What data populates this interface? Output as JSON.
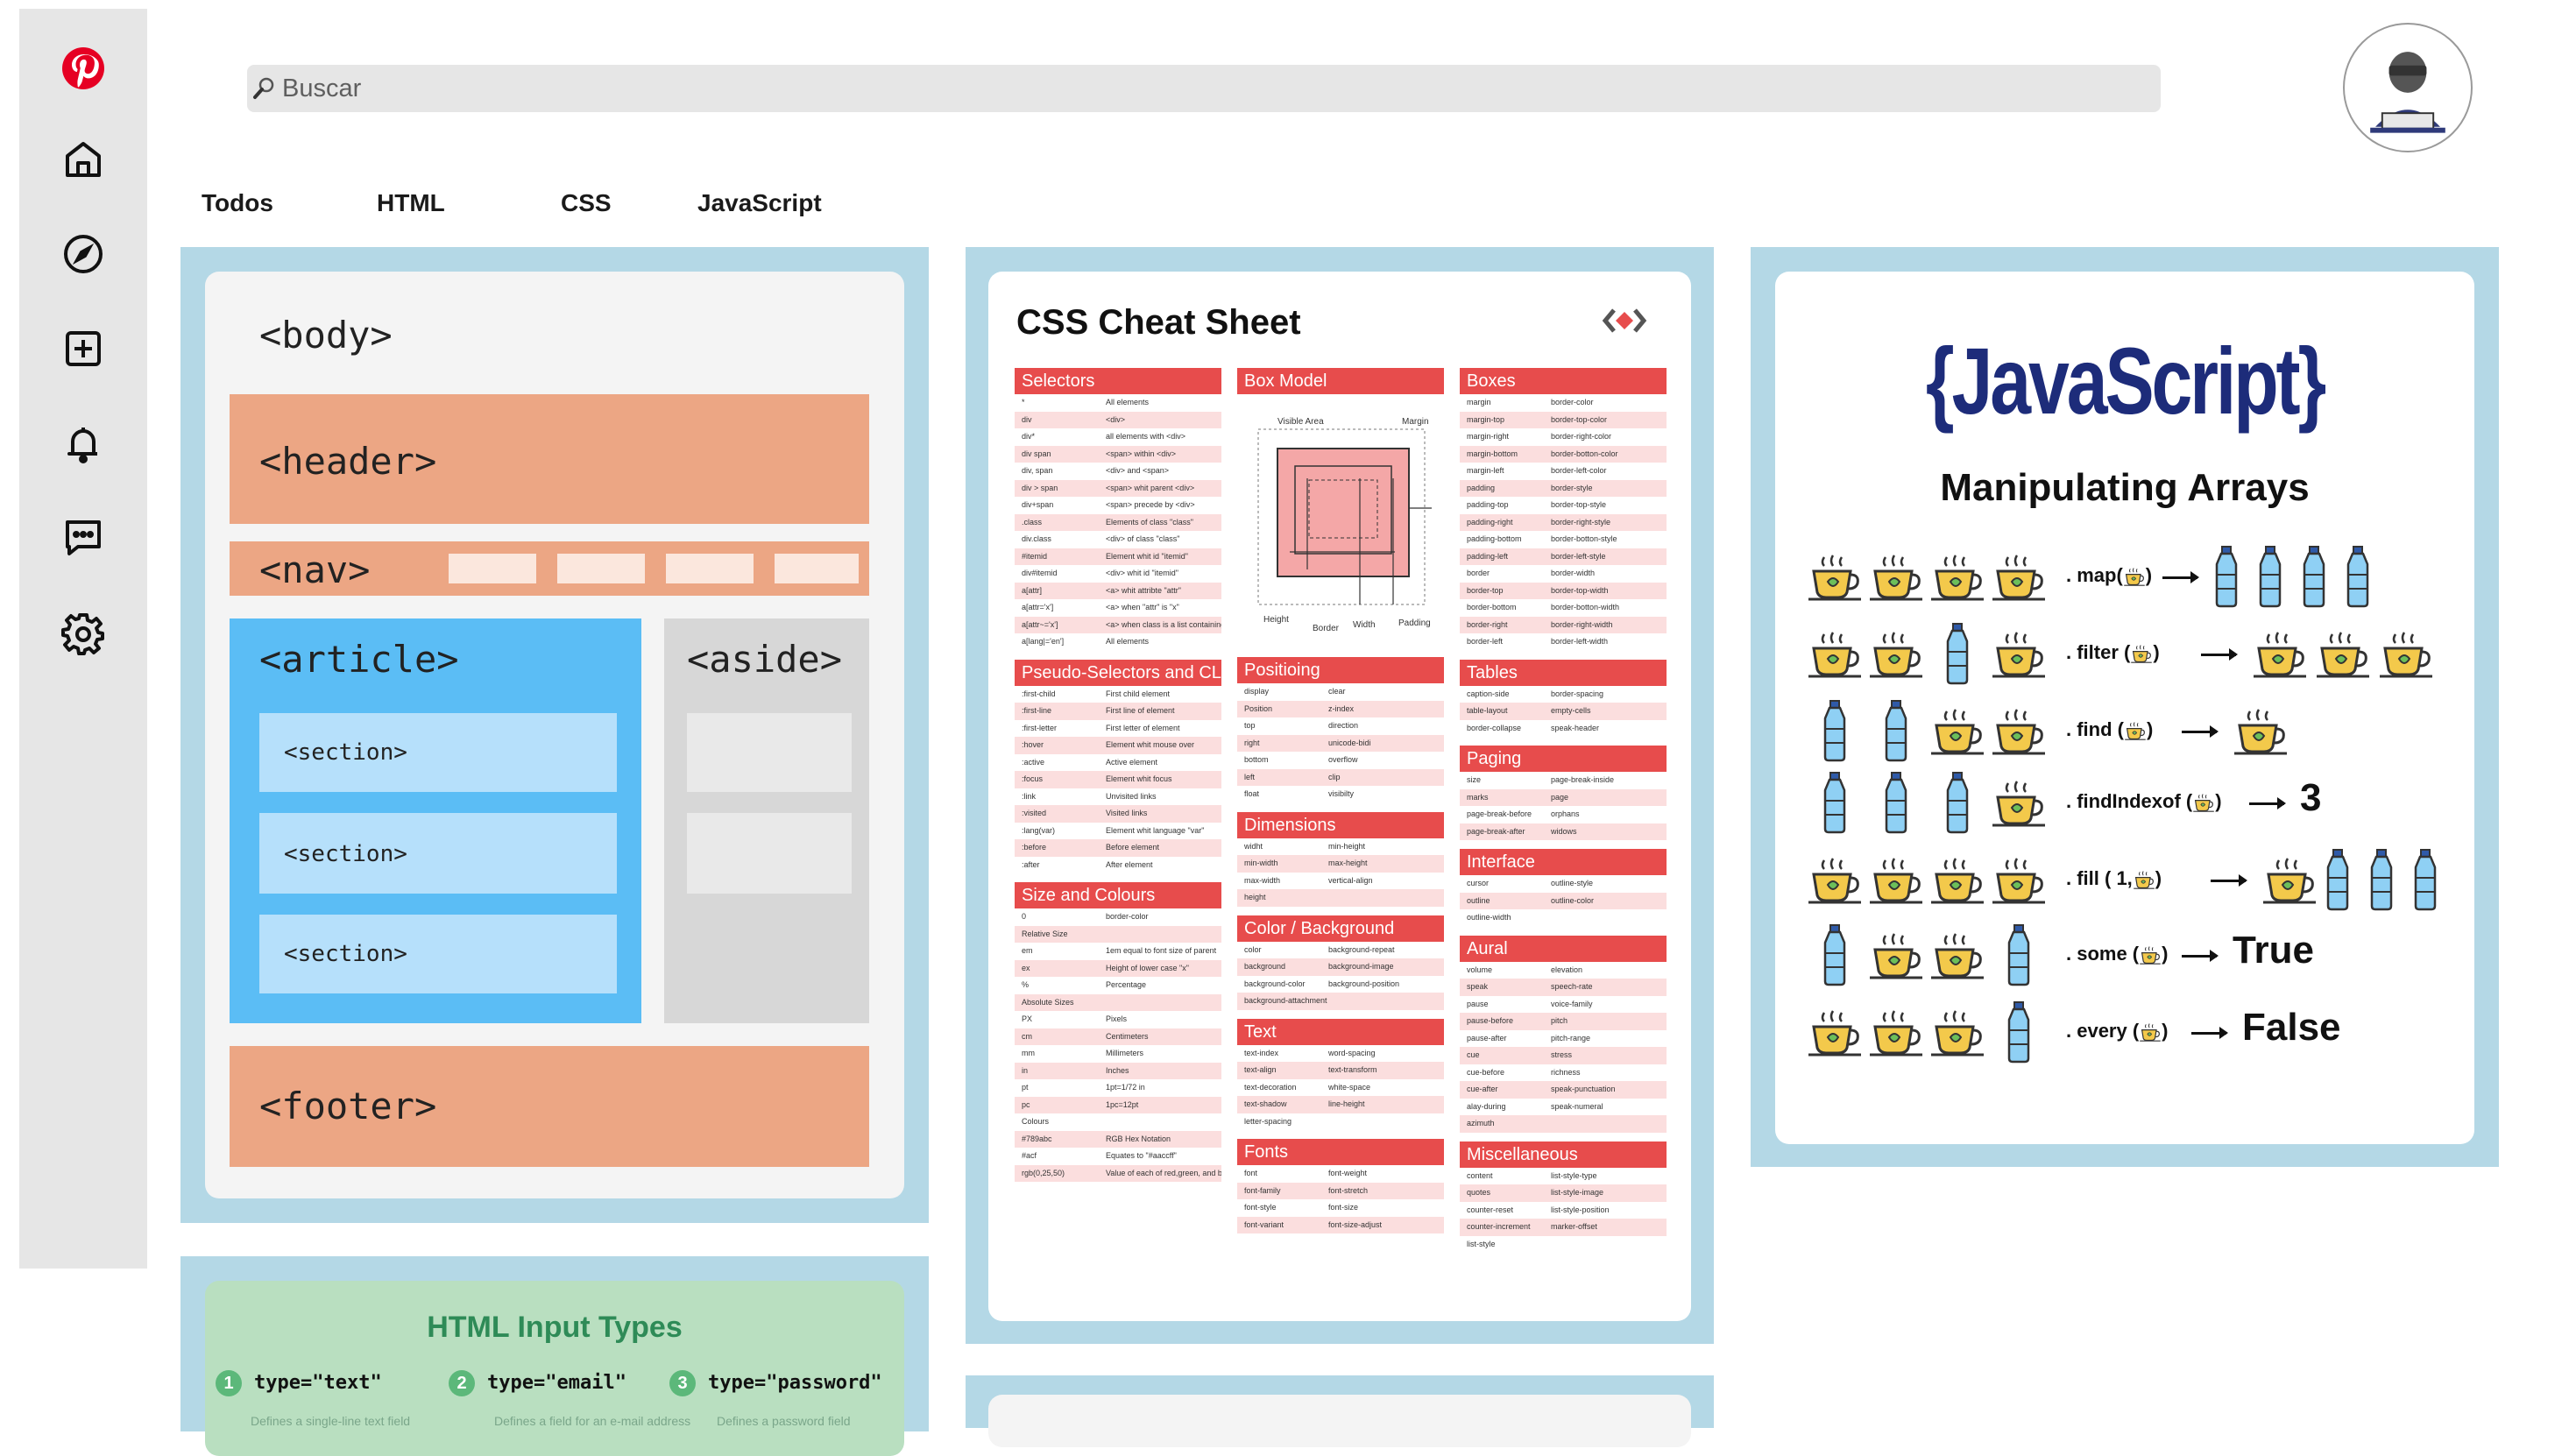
{
  "search": {
    "placeholder": "Buscar"
  },
  "rail": {
    "icons": [
      "pinterest-logo-icon",
      "home-icon",
      "explore-compass-icon",
      "create-plus-icon",
      "notifications-bell-icon",
      "messages-icon",
      "settings-gear-icon"
    ],
    "brand_color": "#e60023"
  },
  "tabs": [
    "Todos",
    "HTML",
    "CSS",
    "JavaScript"
  ],
  "colors": {
    "pin_border": "#b4d8e6",
    "css_red": "#e74c4c",
    "js_blue": "#1d2c7a",
    "html_green": "#2e8b57"
  },
  "pins": {
    "layout": {
      "body": "<body>",
      "header": "<header>",
      "nav": "<nav>",
      "article": "<article>",
      "aside": "<aside>",
      "sections": [
        "<section>",
        "<section>",
        "<section>"
      ],
      "footer": "<footer>"
    },
    "css_cheat": {
      "title": "CSS Cheat Sheet",
      "col1": [
        {
          "heading": "Selectors",
          "rows": [
            [
              "*",
              "All elements"
            ],
            [
              "div",
              "<div>"
            ],
            [
              "div*",
              "all elements with <div>"
            ],
            [
              "div span",
              "<span> within <div>"
            ],
            [
              "div, span",
              "<div> and <span>"
            ],
            [
              "div > span",
              "<span> whit parent <div>"
            ],
            [
              "div+span",
              "<span> precede by <div>"
            ],
            [
              ".class",
              "Elements of class \"class\""
            ],
            [
              "div.class",
              "<div> of class \"class\""
            ],
            [
              "#itemid",
              "Element whit id \"itemid\""
            ],
            [
              "div#itemid",
              "<div> whit id \"itemid\""
            ],
            [
              "a[attr]",
              "<a> whit attribte \"attr\""
            ],
            [
              "a[attr='x']",
              "<a> when \"attr\" is \"x\""
            ],
            [
              "a[attr~='x']",
              "<a> when class is a list containing"
            ],
            [
              "a[lang|='en']",
              "All elements"
            ]
          ]
        },
        {
          "heading": "Pseudo-Selectors and CLasses",
          "rows": [
            [
              ":first-child",
              "First child element"
            ],
            [
              ":first-line",
              "First line of element"
            ],
            [
              ":first-letter",
              "First letter of element"
            ],
            [
              ":hover",
              "Element whit mouse over"
            ],
            [
              ":active",
              "Active element"
            ],
            [
              ":focus",
              "Element whit focus"
            ],
            [
              ":link",
              "Unvisited links"
            ],
            [
              ":visited",
              "Visited links"
            ],
            [
              ":lang(var)",
              "Element whit language \"var\""
            ],
            [
              ":before",
              "Before element"
            ],
            [
              ":after",
              "After element"
            ]
          ]
        },
        {
          "heading": "Size and Colours",
          "rows": [
            [
              "0",
              "border-color"
            ],
            [
              "Relative Size",
              ""
            ],
            [
              "em",
              "1em equal to font size of parent"
            ],
            [
              "ex",
              "Height of lower case \"x\""
            ],
            [
              "%",
              "Percentage"
            ],
            [
              "Absolute Sizes",
              ""
            ],
            [
              "PX",
              "Pixels"
            ],
            [
              "cm",
              "Centimeters"
            ],
            [
              "mm",
              "Millimeters"
            ],
            [
              "in",
              "Inches"
            ],
            [
              "pt",
              "1pt=1/72 in"
            ],
            [
              "pc",
              "1pc=12pt"
            ],
            [
              "Colours",
              ""
            ],
            [
              "#789abc",
              "RGB Hex Notation"
            ],
            [
              "#acf",
              "Equates to \"#aaccff\""
            ],
            [
              "rgb(0,25,50)",
              "Value of each of red,green, and blue"
            ]
          ]
        }
      ],
      "col2": [
        {
          "heading": "Box Model",
          "rows": [],
          "diagram": {
            "visible_area": "Visible Area",
            "margin": "Margin",
            "height": "Height",
            "border": "Border",
            "width": "Width",
            "padding": "Padding"
          }
        },
        {
          "heading": "Positioing",
          "rows": [
            [
              "display",
              "clear"
            ],
            [
              "Position",
              "z-index"
            ],
            [
              "top",
              "direction"
            ],
            [
              "right",
              "unicode-bidi"
            ],
            [
              "bottom",
              "overflow"
            ],
            [
              "left",
              "clip"
            ],
            [
              "float",
              "visibilty"
            ]
          ]
        },
        {
          "heading": "Dimensions",
          "rows": [
            [
              "widht",
              "min-height"
            ],
            [
              "min-width",
              "max-height"
            ],
            [
              "max-width",
              "vertical-align"
            ],
            [
              "height",
              ""
            ]
          ]
        },
        {
          "heading": "Color / Background",
          "rows": [
            [
              "color",
              "background-repeat"
            ],
            [
              "background",
              "background-image"
            ],
            [
              "background-color",
              "background-position"
            ],
            [
              "background-attachment",
              ""
            ]
          ]
        },
        {
          "heading": "Text",
          "rows": [
            [
              "text-index",
              "word-spacing"
            ],
            [
              "text-align",
              "text-transform"
            ],
            [
              "text-decoration",
              "white-space"
            ],
            [
              "text-shadow",
              "line-height"
            ],
            [
              "letter-spacing",
              ""
            ]
          ]
        },
        {
          "heading": "Fonts",
          "rows": [
            [
              "font",
              "font-weight"
            ],
            [
              "font-family",
              "font-stretch"
            ],
            [
              "font-style",
              "font-size"
            ],
            [
              "font-variant",
              "font-size-adjust"
            ]
          ]
        }
      ],
      "col3": [
        {
          "heading": "Boxes",
          "rows": [
            [
              "margin",
              "border-color"
            ],
            [
              "margin-top",
              "border-top-color"
            ],
            [
              "margin-right",
              "border-right-color"
            ],
            [
              "margin-bottom",
              "border-botton-color"
            ],
            [
              "margin-left",
              "border-left-color"
            ],
            [
              "padding",
              "border-style"
            ],
            [
              "padding-top",
              "border-top-style"
            ],
            [
              "padding-right",
              "border-right-style"
            ],
            [
              "padding-bottom",
              "border-botton-style"
            ],
            [
              "padding-left",
              "border-left-style"
            ],
            [
              "border",
              "border-width"
            ],
            [
              "border-top",
              "border-top-width"
            ],
            [
              "border-bottom",
              "border-botton-width"
            ],
            [
              "border-right",
              "border-right-width"
            ],
            [
              "border-left",
              "border-left-width"
            ]
          ]
        },
        {
          "heading": "Tables",
          "rows": [
            [
              "caption-side",
              "border-spacing"
            ],
            [
              "table-layout",
              "empty-cells"
            ],
            [
              "border-collapse",
              "speak-header"
            ]
          ]
        },
        {
          "heading": "Paging",
          "rows": [
            [
              "size",
              "page-break-inside"
            ],
            [
              "marks",
              "page"
            ],
            [
              "page-break-before",
              "orphans"
            ],
            [
              "page-break-after",
              "widows"
            ]
          ]
        },
        {
          "heading": "Interface",
          "rows": [
            [
              "cursor",
              "outline-style"
            ],
            [
              "outline",
              "outline-color"
            ],
            [
              "outline-width",
              ""
            ]
          ]
        },
        {
          "heading": "Aural",
          "rows": [
            [
              "volume",
              "elevation"
            ],
            [
              "speak",
              "speech-rate"
            ],
            [
              "pause",
              "voice-family"
            ],
            [
              "pause-before",
              "pitch"
            ],
            [
              "pause-after",
              "pitch-range"
            ],
            [
              "cue",
              "stress"
            ],
            [
              "cue-before",
              "richness"
            ],
            [
              "cue-after",
              "speak-punctuation"
            ],
            [
              "alay-during",
              "speak-numeral"
            ],
            [
              "azimuth",
              ""
            ]
          ]
        },
        {
          "heading": "Miscellaneous",
          "rows": [
            [
              "content",
              "list-style-type"
            ],
            [
              "quotes",
              "list-style-image"
            ],
            [
              "counter-reset",
              "list-style-position"
            ],
            [
              "counter-increment",
              "marker-offset"
            ],
            [
              "list-style",
              ""
            ]
          ]
        }
      ]
    },
    "js_arrays": {
      "title": "{JavaScript}",
      "subtitle": "Manipulating Arrays",
      "rows": [
        {
          "input": [
            "cup",
            "cup",
            "cup",
            "cup"
          ],
          "method": ". map(",
          "close": ")",
          "output": [
            "bottle",
            "bottle",
            "bottle",
            "bottle"
          ]
        },
        {
          "input": [
            "cup",
            "cup",
            "bottle",
            "cup"
          ],
          "method": ". filter (",
          "close": ")",
          "output": [
            "cup",
            "cup",
            "cup"
          ]
        },
        {
          "input": [
            "bottle",
            "bottle",
            "cup",
            "cup"
          ],
          "method": ". find (",
          "close": ")",
          "output": [
            "cup"
          ]
        },
        {
          "input": [
            "bottle",
            "bottle",
            "bottle",
            "cup"
          ],
          "method": ". findIndexof (",
          "close": ")",
          "result": "3"
        },
        {
          "input": [
            "cup",
            "cup",
            "cup",
            "cup"
          ],
          "method": ". fill ( 1,",
          "close": ")",
          "output": [
            "cup",
            "bottle",
            "bottle",
            "bottle"
          ]
        },
        {
          "input": [
            "bottle",
            "cup",
            "cup",
            "bottle"
          ],
          "method": ". some (",
          "close": ")",
          "result": "True"
        },
        {
          "input": [
            "cup",
            "cup",
            "cup",
            "bottle"
          ],
          "method": ". every (",
          "close": ")",
          "result": "False"
        }
      ]
    },
    "html_inputs": {
      "title": "HTML Input Types",
      "items": [
        {
          "num": "1",
          "label": "type=\"text\"",
          "desc": "Defines a single-line text field"
        },
        {
          "num": "2",
          "label": "type=\"email\"",
          "desc": "Defines a field for an e-mail address"
        },
        {
          "num": "3",
          "label": "type=\"password\"",
          "desc": "Defines a password field"
        }
      ]
    }
  }
}
